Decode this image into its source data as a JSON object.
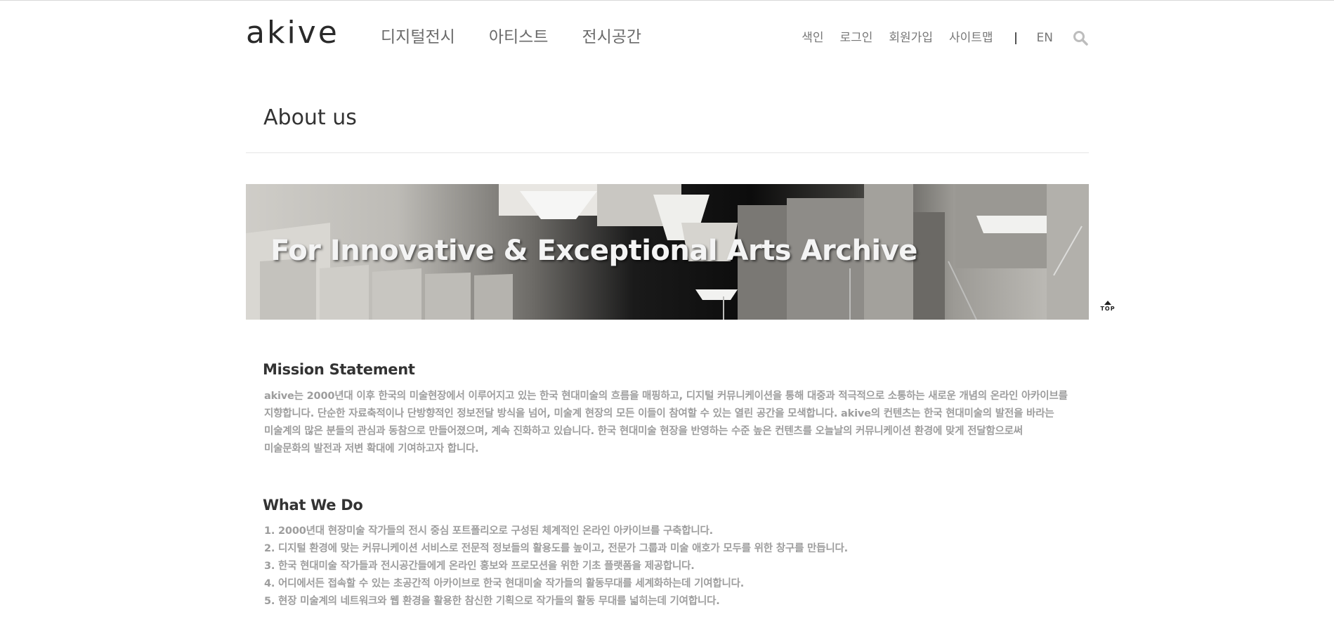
{
  "header": {
    "logo": "akive",
    "gnb": [
      "디지털전시",
      "아티스트",
      "전시공간"
    ],
    "util": {
      "index": "색인",
      "login": "로그인",
      "join": "회원가입",
      "sitemap": "사이트맵",
      "lang": "EN"
    }
  },
  "page": {
    "title": "About us"
  },
  "banner": {
    "text": "For Innovative & Exceptional Arts Archive"
  },
  "mission": {
    "heading": "Mission Statement",
    "lines": [
      "akive는 2000년대 이후 한국의 미술현장에서 이루어지고 있는 한국 현대미술의 흐름을 매핑하고, 디지털 커뮤니케이션을 통해 대중과 적극적으로 소통하는 새로운 개념의 온라인 아카이브를",
      "지향합니다. 단순한 자료축적이나 단방향적인 정보전달 방식을 넘어, 미술계 현장의 모든 이들이 참여할 수 있는 열린 공간을 모색합니다. akive의 컨텐츠는 한국 현대미술의 발전을 바라는",
      "미술계의 많은 분들의 관심과 동참으로 만들어졌으며, 계속 진화하고 있습니다. 한국 현대미술 현장을 반영하는 수준 높은 컨텐츠를 오늘날의 커뮤니케이션 환경에 맞게 전달함으로써",
      "미술문화의 발전과 저변 확대에 기여하고자 합니다."
    ]
  },
  "whatwedo": {
    "heading": "What We Do",
    "items": [
      "1. 2000년대 현장미술 작가들의 전시 중심 포트폴리오로 구성된 체계적인 온라인 아카이브를 구축합니다.",
      "2. 디지털 환경에 맞는 커뮤니케이션 서비스로 전문적 정보들의 활용도를 높이고, 전문가 그룹과 미술 애호가 모두를 위한 창구를 만듭니다.",
      "3. 한국 현대미술 작가들과 전시공간들에게 온라인 홍보와 프로모션을 위한 기초 플랫폼을 제공합니다.",
      "4. 어디에서든 접속할 수 있는 초공간적 아카이브로 한국 현대미술 작가들의 활동무대를 세계화하는데 기여합니다.",
      "5. 현장 미술계의 네트워크와 웹 환경을 활용한 참신한 기획으로 작가들의 활동 무대를 넓히는데 기여합니다."
    ]
  },
  "top_button": {
    "label": "TOP"
  }
}
